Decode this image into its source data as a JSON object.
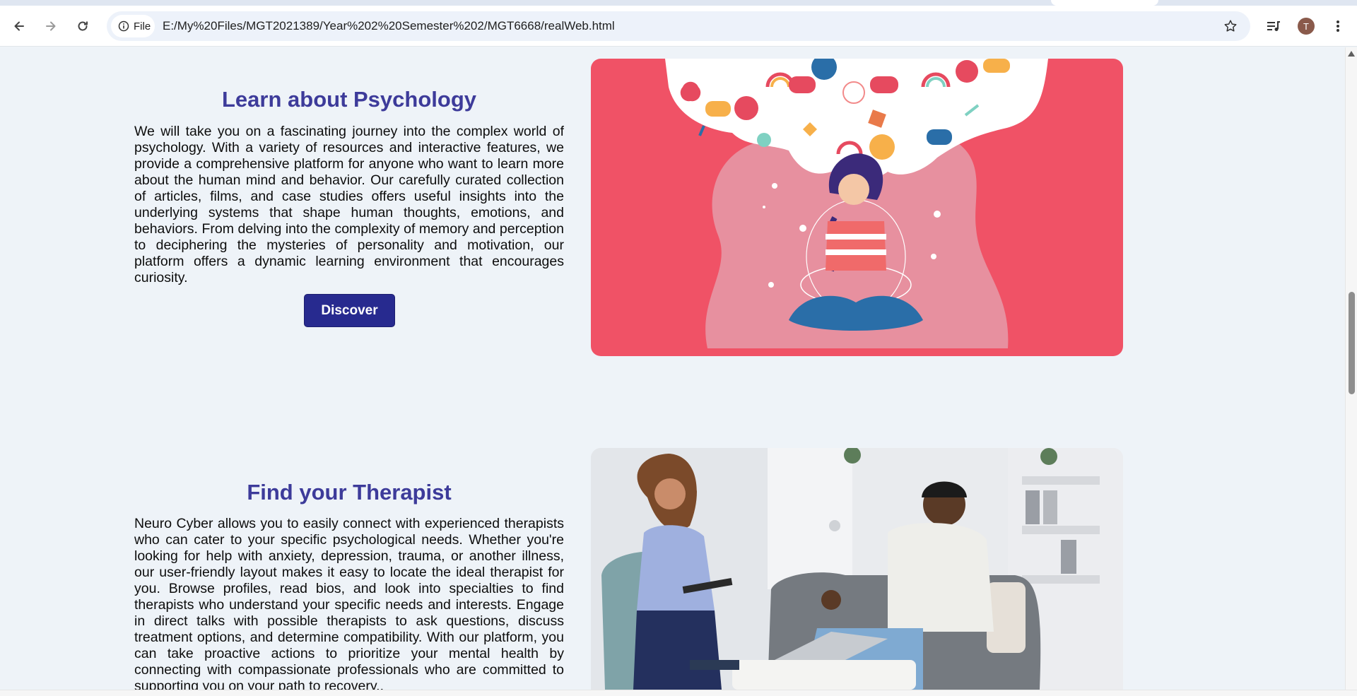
{
  "browser": {
    "scheme_chip": "File",
    "url": "E:/My%20Files/MGT2021389/Year%202%20Semester%202/MGT6668/realWeb.html",
    "profile_initial": "T"
  },
  "sections": [
    {
      "title": "Learn about Psychology",
      "text": "We will take you on a fascinating journey into the complex world of psychology. With a variety of resources and interactive features, we provide a comprehensive platform for anyone who want to learn more about the human mind and behavior. Our carefully curated collection of articles, films, and case studies offers useful insights into the underlying systems that shape human thoughts, emotions, and behaviors. From delving into the complexity of memory and perception to deciphering the mysteries of personality and motivation, our platform offers a dynamic learning environment that encourages curiosity.",
      "button": "Discover"
    },
    {
      "title": "Find your Therapist",
      "text": "Neuro Cyber allows you to easily connect with experienced therapists who can cater to your specific psychological needs. Whether you're looking for help with anxiety, depression, trauma, or another illness, our user-friendly layout makes it easy to locate the ideal therapist for you. Browse profiles, read bios, and look into specialties to find therapists who understand your specific needs and interests. Engage in direct talks with possible therapists to ask questions, discuss treatment options, and determine compatibility. With our platform, you can take proactive actions to prioritize your mental health by connecting with compassionate professionals who are committed to supporting you on your path to recovery.."
    }
  ],
  "colors": {
    "heading": "#3d3b9a",
    "button_bg": "#272a8f",
    "illustration_bg": "#f05266",
    "page_bg": "#eef3f8"
  }
}
